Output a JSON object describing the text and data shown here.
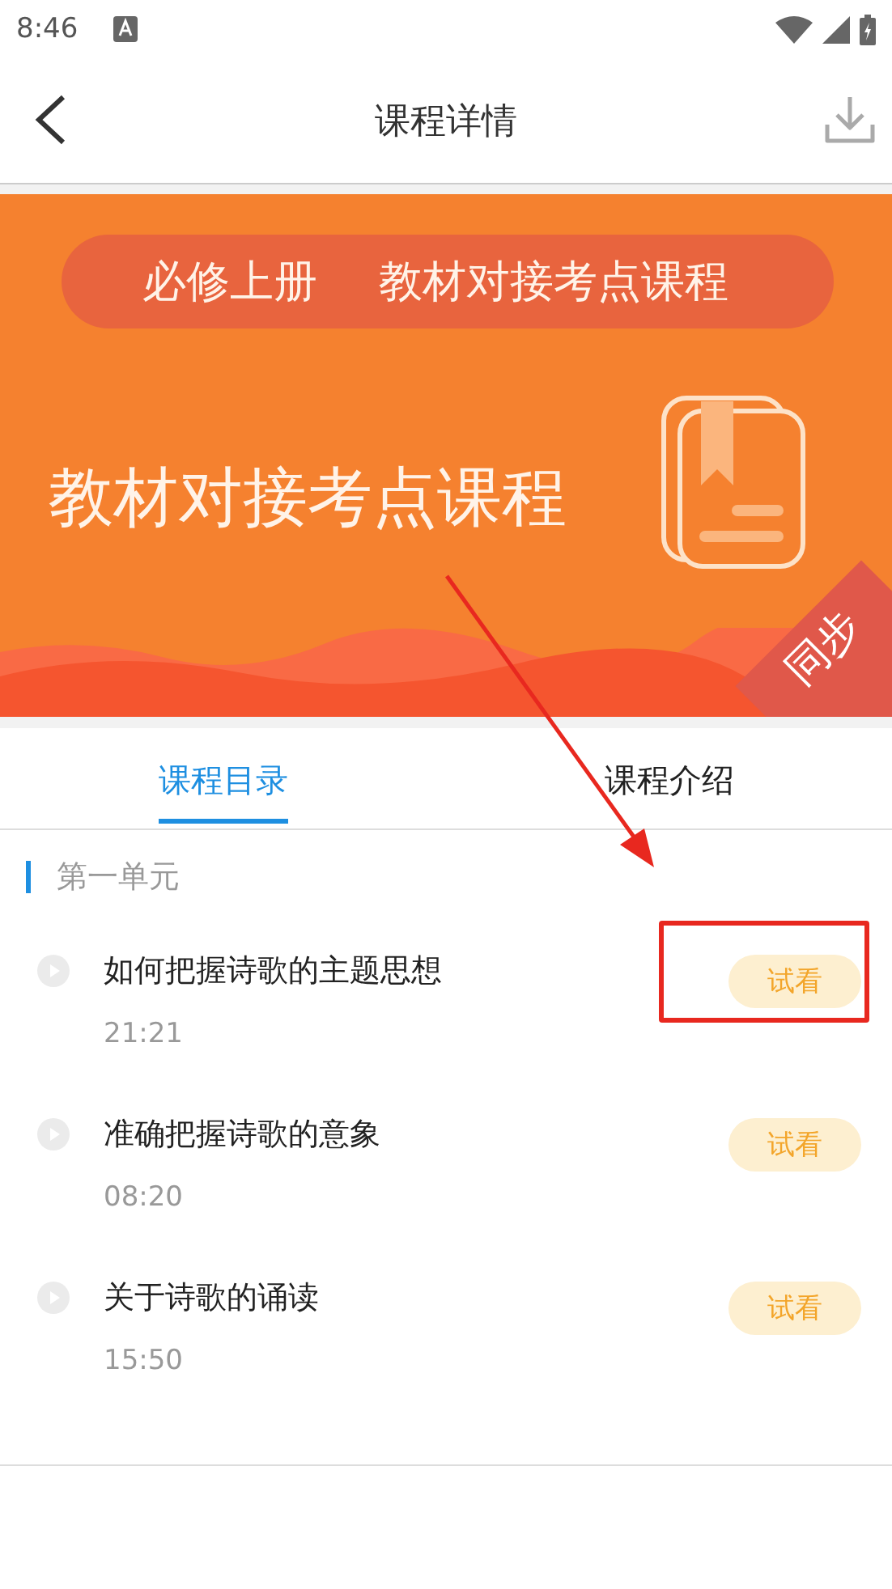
{
  "status_bar": {
    "time": "8:46"
  },
  "header": {
    "title": "课程详情"
  },
  "banner": {
    "tag_left": "必修上册",
    "tag_right": "教材对接考点课程",
    "title": "教材对接考点课程",
    "corner": "同步"
  },
  "tabs": [
    {
      "label": "课程目录",
      "selected": true
    },
    {
      "label": "课程介绍",
      "selected": false
    }
  ],
  "sections": [
    {
      "title": "第一单元",
      "lessons": [
        {
          "title": "如何把握诗歌的主题思想",
          "duration": "21:21",
          "button": "试看",
          "highlighted": true
        },
        {
          "title": "准确把握诗歌的意象",
          "duration": "08:20",
          "button": "试看",
          "highlighted": false
        },
        {
          "title": "关于诗歌的诵读",
          "duration": "15:50",
          "button": "试看",
          "highlighted": false
        }
      ]
    }
  ]
}
